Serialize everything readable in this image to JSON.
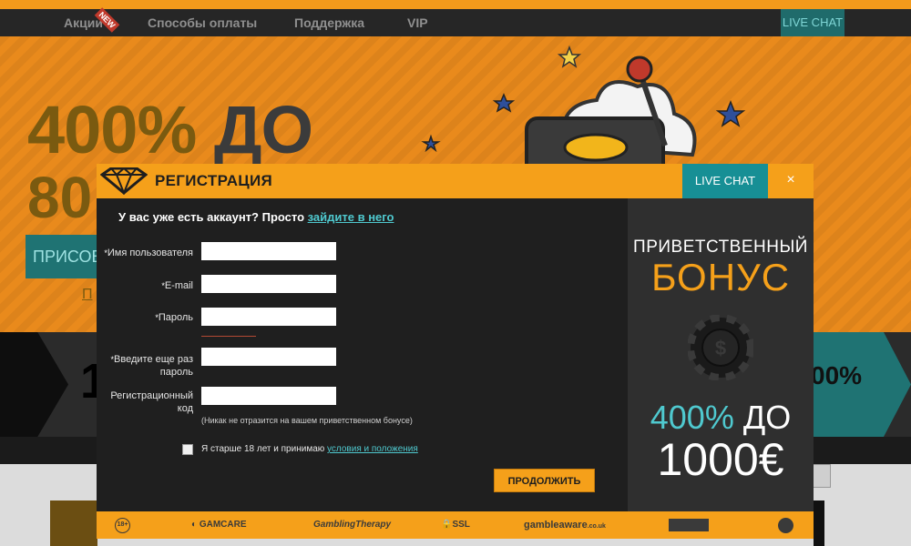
{
  "nav": {
    "items": [
      "Акции",
      "Способы оплаты",
      "Поддержка",
      "VIP"
    ],
    "new_badge": "NEW",
    "live_chat": "LIVE CHAT"
  },
  "hero": {
    "line1_pct": "400%",
    "line1_word": "ДО",
    "line2": "80",
    "button": "ПРИСОЕ",
    "link": "П"
  },
  "band": {
    "number": "1",
    "percent": "00%"
  },
  "modal": {
    "title": "РЕГИСТРАЦИЯ",
    "live_chat": "LIVE CHAT",
    "close": "×",
    "have_account": "У вас уже есть аккаунт? Просто ",
    "have_account_link": "зайдите в него",
    "fields": {
      "username": "Имя пользователя",
      "email": "E-mail",
      "password": "Пароль",
      "password_repeat_1": "Введите еще раз",
      "password_repeat_2": "пароль",
      "reg_code_1": "Регистрационный",
      "reg_code_2": "код",
      "required_mark": "*"
    },
    "reg_code_hint": "(Никак не отразится на вашем приветственном бонусе)",
    "agree_text": "Я старше 18 лет и принимаю ",
    "agree_link": "условия и положения",
    "submit": "ПРОДОЛЖИТЬ",
    "bonus": {
      "line1": "ПРИВЕТСТВЕННЫЙ",
      "line2": "БОНУС",
      "line3_pct": "400%",
      "line3_rest": " ДО",
      "line4": "1000€"
    },
    "footer": {
      "age": "18+",
      "gamcare": "GAMCARE",
      "gambling_therapy": "GamblingTherapy",
      "ssl": "SSL",
      "gambleaware": "gambleaware",
      "gambleaware_suffix": ".co.uk"
    }
  },
  "colors": {
    "accent": "#f5a01a",
    "teal": "#178f95",
    "link": "#4fc9cf",
    "panel": "#1f1f1f"
  }
}
